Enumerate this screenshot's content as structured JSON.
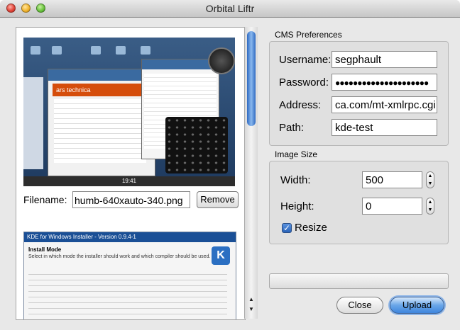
{
  "window": {
    "title": "Orbital Liftr"
  },
  "left_panel": {
    "screenshot1": {
      "site": "ars technica",
      "clock": "19:41"
    },
    "screenshot2": {
      "title": "KDE for Windows Installer - Version 0.9.4-1",
      "heading": "Install Mode",
      "subheading": "Select in which mode the installer should work and which compiler should be used.",
      "logo": "K"
    },
    "filename_label": "Filename:",
    "filename_value": "humb-640xauto-340.png",
    "remove_button": "Remove"
  },
  "cms": {
    "title": "CMS Preferences",
    "username_label": "Username:",
    "username_value": "segphault",
    "password_label": "Password:",
    "password_value": "●●●●●●●●●●●●●●●●●●●●●",
    "address_label": "Address:",
    "address_value": "ca.com/mt-xmlrpc.cgi",
    "path_label": "Path:",
    "path_value": "kde-test"
  },
  "image_size": {
    "title": "Image Size",
    "width_label": "Width:",
    "width_value": "500",
    "height_label": "Height:",
    "height_value": "0",
    "resize_label": "Resize",
    "resize_checked": true
  },
  "buttons": {
    "close": "Close",
    "upload": "Upload"
  },
  "colors": {
    "accent": "#3f86de",
    "ars_brand": "#d54d0b"
  }
}
